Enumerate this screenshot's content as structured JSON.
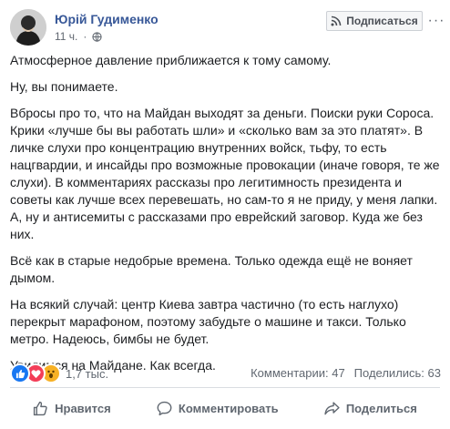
{
  "post": {
    "author": "Юрій Гудименко",
    "time": "11 ч.",
    "follow_label": "Подписаться",
    "more_label": "···",
    "paragraphs": [
      "Атмосферное давление приближается к тому самому.",
      "Ну, вы понимаете.",
      "Вбросы про то, что на Майдан выходят за деньги. Поиски руки Сороса. Крики «лучше бы вы работать шли» и «сколько вам за это платят». В личке слухи про концентрацию внутренних войск, тьфу, то есть нацгвардии, и инсайды про возможные провокации (иначе говоря, те же слухи). В комментариях рассказы про легитимность президента и советы как лучше всех перевешать, но сам-то я не приду, у меня лапки. А, ну и антисемиты с рассказами про еврейский заговор. Куда же без них.",
      "Всё как в старые недобрые времена. Только одежда ещё не воняет дымом.",
      "На всякий случай: центр Киева завтра частично (то есть наглухо) перекрыт марафоном, поэтому забудьте о машине и такси. Только метро. Надеюсь, бимбы не будет.",
      "Увидимся на Майдане. Как всегда."
    ]
  },
  "reactions": {
    "count": "1,7 тыс.",
    "types": [
      "like-icon",
      "love-icon",
      "wow-icon"
    ]
  },
  "stats": {
    "comments": "Комментарии: 47",
    "shares": "Поделились: 63"
  },
  "actions": {
    "like": "Нравится",
    "comment": "Комментировать",
    "share": "Поделиться"
  },
  "colors": {
    "author": "#385898",
    "meta": "#606770",
    "like": "#1877f2",
    "love": "#f33e58",
    "wow": "#f7b125"
  }
}
